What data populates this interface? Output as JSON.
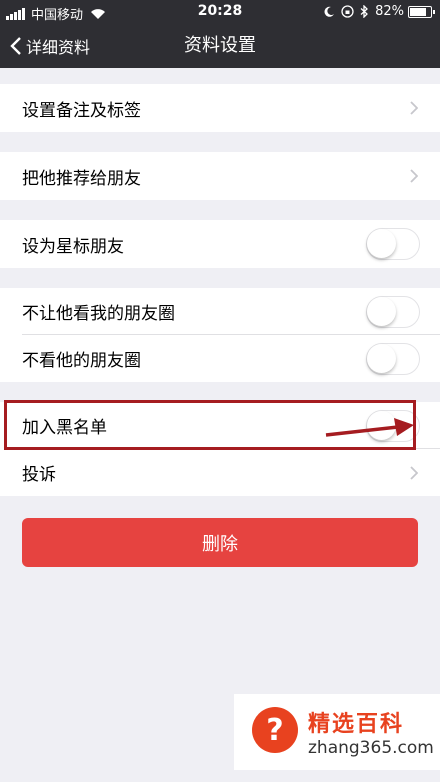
{
  "status_bar": {
    "carrier": "中国移动",
    "time": "20:28",
    "battery": "82%",
    "battery_level": 0.82
  },
  "nav": {
    "back_label": "详细资料",
    "title": "资料设置"
  },
  "settings": {
    "remark_tags": "设置备注及标签",
    "recommend": "把他推荐给朋友",
    "star_friend": "设为星标朋友",
    "hide_my_moments": "不让他看我的朋友圈",
    "hide_his_moments": "不看他的朋友圈",
    "blacklist": "加入黑名单",
    "complain": "投诉"
  },
  "toggles": {
    "star_friend": false,
    "hide_my_moments": false,
    "hide_his_moments": false,
    "blacklist": false
  },
  "delete_label": "删除",
  "watermark": {
    "title": "精选百科",
    "url": "zhang365.com"
  },
  "colors": {
    "nav_bg": "#2e2e33",
    "page_bg": "#efeff4",
    "delete_red": "#e64340",
    "annotation_red": "#a51c20"
  }
}
